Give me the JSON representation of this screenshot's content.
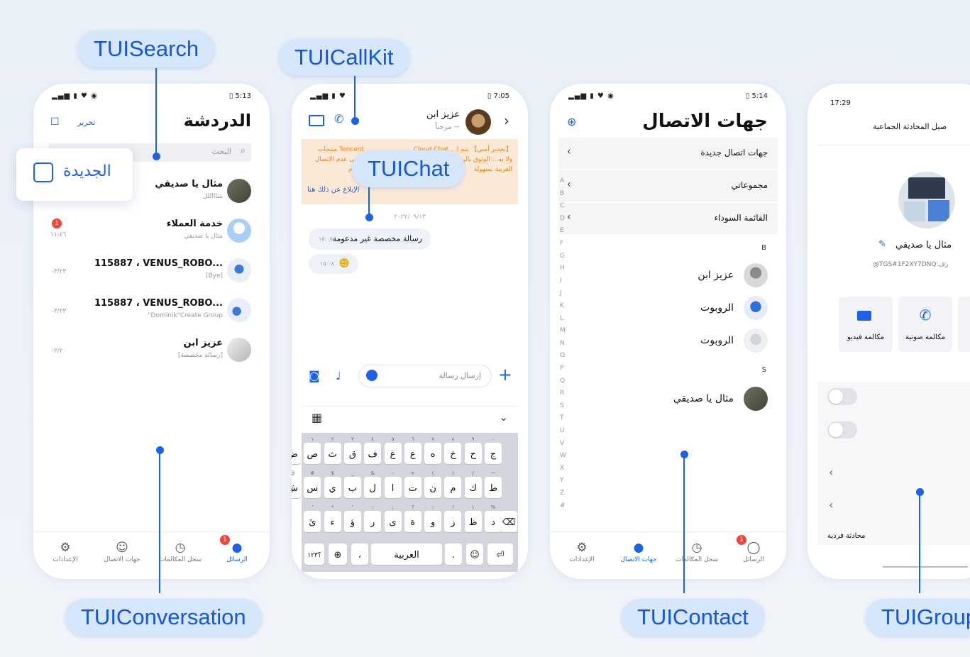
{
  "labels": {
    "search": "TUISearch",
    "callkit": "TUICallKit",
    "chat": "TUIChat",
    "conversation": "TUIConversation",
    "contact": "TUIContact",
    "group": "TUIGroup"
  },
  "colors": {
    "accent": "#1c62e8",
    "badge": "#f5423a",
    "label_bg": "#d6e6fb"
  },
  "conv_screen": {
    "status_time": "5:13",
    "title": "الدردشة",
    "edit": "تحرير",
    "search_placeholder": "البحث",
    "new_popup": "الجديدة",
    "items": [
      {
        "name": "مثال يا صديقي",
        "sub": "ننتاااللل",
        "time": ""
      },
      {
        "name": "خدمة العملاء",
        "sub": "مثال يا صديقي",
        "time": "١١:٤٦",
        "badge": "1"
      },
      {
        "name": "115887 ، VENUS_ROBO...",
        "sub": "[Bye]",
        "time": "٠٣/٢٣"
      },
      {
        "name": "115887 ، VENUS_ROBO...",
        "sub": "\"Dominik\"Create Group",
        "time": "٠٣/٢٣"
      },
      {
        "name": "عزيز ابن",
        "sub": "[رسالة مخصصة]",
        "time": "٠٢/٢٠"
      }
    ],
    "tabs": [
      "الإعدادات",
      "جهات الاتصال",
      "سجل المكالمات",
      "الرسائل"
    ],
    "tab_badge": "1"
  },
  "chat_screen": {
    "status_time": "7:05",
    "name": "عزيز ابن",
    "status": "مرحباً ~",
    "notice_red": "【تحذير أمني】 يتم ا... Cloud Chat ولا يه... الوثوق بالرسائل التي... الهواتف الغريبة بسهولة",
    "notice_tencent": "Tencent منتجات يرجى عدم الاتصال بأرقام",
    "report_link": "الإبلاغ عن ذلك هنا",
    "date": "٢٠٢٢/٠٩/١٣",
    "msg1": "رسالة مخصصة غير مدعومة",
    "msg1_time": "١٥:٠٨",
    "msg2_time": "١٥:٠٨",
    "input_placeholder": "إرسال رسالة",
    "kb_row1": [
      "ج",
      "ح",
      "خ",
      "ه",
      "ع",
      "غ",
      "ف",
      "ق",
      "ث",
      "ص",
      "ض"
    ],
    "kb_row1_small": [
      "٠",
      "٩",
      "٨",
      "٧",
      "٦",
      "٥",
      "٤",
      "٣",
      "٢",
      "١"
    ],
    "kb_row2": [
      "ط",
      "ك",
      "م",
      "ن",
      "ت",
      "ا",
      "ل",
      "ب",
      "ي",
      "س",
      "ش"
    ],
    "kb_row2_small": [
      "~",
      "/",
      ")",
      "(",
      "+",
      "-",
      "&",
      "_",
      "$",
      "#",
      "@"
    ],
    "kb_row3": [
      "د",
      "ظ",
      "ز",
      "و",
      "ة",
      "ى",
      "ر",
      "ؤ",
      "ء",
      "ئ"
    ],
    "kb_row3_small": [
      "%",
      "\\",
      "!",
      ":",
      "?",
      ";",
      ":",
      "'",
      "*",
      "'"
    ],
    "kb_space": "العربية",
    "kb_num": "؟١٢٣"
  },
  "contact_screen": {
    "status_time": "5:14",
    "title": "جهات الاتصال",
    "rows": [
      "جهات اتصال جديدة",
      "مجموعاتي",
      "القائمة السوداء"
    ],
    "section_b": "B",
    "section_s": "S",
    "contacts_b": [
      "عزيز ابن",
      "الروبوت",
      "الروبوت"
    ],
    "contacts_s": [
      "مثال يا صديقي"
    ],
    "alphabet": [
      "A",
      "B",
      "C",
      "D",
      "E",
      "F",
      "G",
      "H",
      "I",
      "J",
      "K",
      "L",
      "M",
      "N",
      "O",
      "P",
      "Q",
      "R",
      "S",
      "T",
      "U",
      "V",
      "W",
      "X",
      "Y",
      "Z",
      "#"
    ],
    "tabs": [
      "الإعدادات",
      "جهات الاتصال",
      "سجل المكالمات",
      "الرسائل"
    ],
    "tab_badge": "1"
  },
  "group_screen": {
    "status_time": "17:29",
    "header": "صيل المحادثة الجماعية",
    "name": "مثال يا صديقي",
    "id": "@TGS#1F2XY7DNQ:رف",
    "video_call": "مكالمة فيديو",
    "voice_call": "مكالمة صوتية",
    "one_on_one": "محادثة فردية"
  }
}
